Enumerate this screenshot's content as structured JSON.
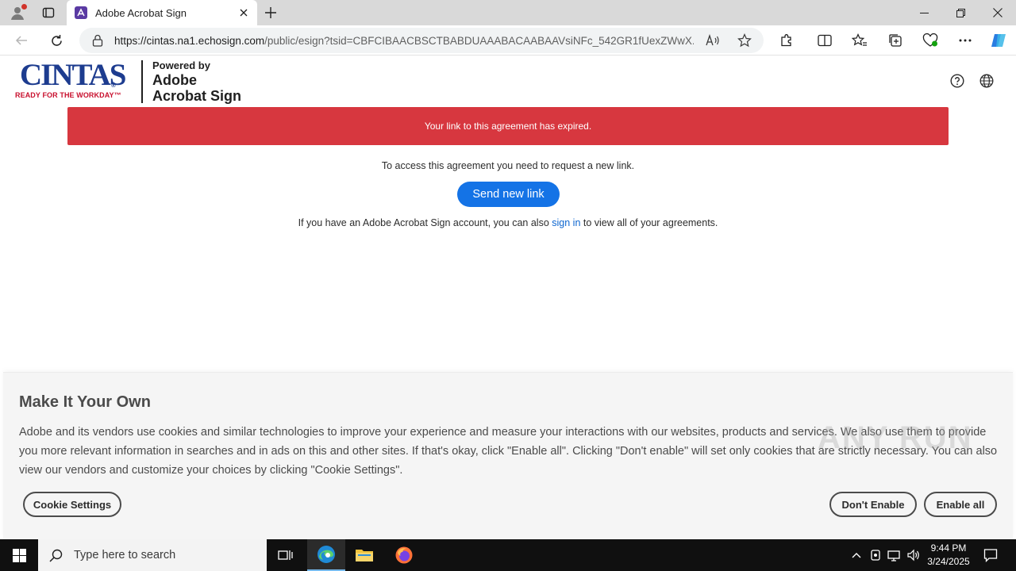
{
  "browser": {
    "tab_title": "Adobe Acrobat Sign",
    "url_host": "https://cintas.na1.echosign.com",
    "url_path": "/public/esign?tsid=CBFCIBAACBSCTBABDUAAABACAABAAVsiNFc_542GR1fUexZWwX..."
  },
  "header": {
    "logo_word": "CINTAS",
    "logo_reg": "®",
    "logo_tagline": "READY FOR THE WORKDAY™",
    "powered_by": "Powered by",
    "product_line1": "Adobe",
    "product_line2": "Acrobat Sign"
  },
  "main": {
    "error_message": "Your link to this agreement has expired.",
    "access_message": "To access this agreement you need to request a new link.",
    "send_button": "Send new link",
    "signin_prefix": "If you have an Adobe Acrobat Sign account, you can also ",
    "signin_link": "sign in",
    "signin_suffix": " to view all of your agreements."
  },
  "cookie": {
    "title": "Make It Your Own",
    "body": "Adobe and its vendors use cookies and similar technologies to improve your experience and measure your interactions with our websites, products and services. We also use them to provide you more relevant information in searches and in ads on this and other sites. If that's okay, click \"Enable all\". Clicking \"Don't enable\" will set only cookies that are strictly necessary. You can also view our vendors and customize your choices by clicking \"Cookie Settings\".",
    "settings_button": "Cookie Settings",
    "dont_enable_button": "Don't Enable",
    "enable_all_button": "Enable all"
  },
  "watermark": "ANY RUN",
  "taskbar": {
    "search_placeholder": "Type here to search",
    "time": "9:44 PM",
    "date": "3/24/2025"
  },
  "colors": {
    "error_red": "#d7373f",
    "primary_blue": "#1473e6",
    "cintas_blue": "#1d3c8f",
    "cintas_red": "#c8102e"
  }
}
